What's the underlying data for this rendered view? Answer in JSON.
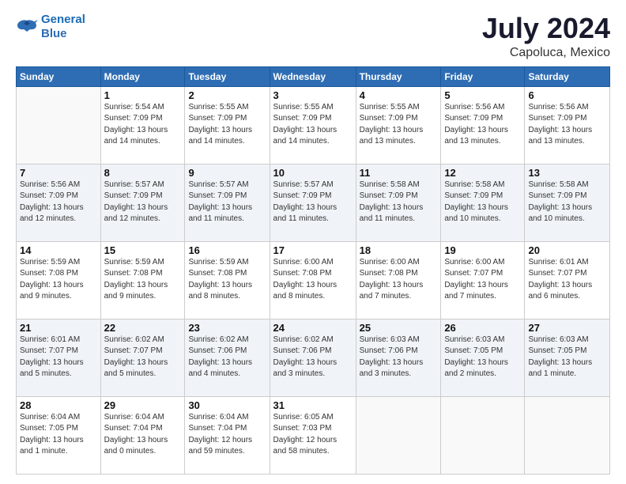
{
  "logo": {
    "line1": "General",
    "line2": "Blue"
  },
  "title": "July 2024",
  "location": "Capoluca, Mexico",
  "days_of_week": [
    "Sunday",
    "Monday",
    "Tuesday",
    "Wednesday",
    "Thursday",
    "Friday",
    "Saturday"
  ],
  "weeks": [
    [
      {
        "day": "",
        "info": ""
      },
      {
        "day": "1",
        "info": "Sunrise: 5:54 AM\nSunset: 7:09 PM\nDaylight: 13 hours\nand 14 minutes."
      },
      {
        "day": "2",
        "info": "Sunrise: 5:55 AM\nSunset: 7:09 PM\nDaylight: 13 hours\nand 14 minutes."
      },
      {
        "day": "3",
        "info": "Sunrise: 5:55 AM\nSunset: 7:09 PM\nDaylight: 13 hours\nand 14 minutes."
      },
      {
        "day": "4",
        "info": "Sunrise: 5:55 AM\nSunset: 7:09 PM\nDaylight: 13 hours\nand 13 minutes."
      },
      {
        "day": "5",
        "info": "Sunrise: 5:56 AM\nSunset: 7:09 PM\nDaylight: 13 hours\nand 13 minutes."
      },
      {
        "day": "6",
        "info": "Sunrise: 5:56 AM\nSunset: 7:09 PM\nDaylight: 13 hours\nand 13 minutes."
      }
    ],
    [
      {
        "day": "7",
        "info": "Sunrise: 5:56 AM\nSunset: 7:09 PM\nDaylight: 13 hours\nand 12 minutes."
      },
      {
        "day": "8",
        "info": "Sunrise: 5:57 AM\nSunset: 7:09 PM\nDaylight: 13 hours\nand 12 minutes."
      },
      {
        "day": "9",
        "info": "Sunrise: 5:57 AM\nSunset: 7:09 PM\nDaylight: 13 hours\nand 11 minutes."
      },
      {
        "day": "10",
        "info": "Sunrise: 5:57 AM\nSunset: 7:09 PM\nDaylight: 13 hours\nand 11 minutes."
      },
      {
        "day": "11",
        "info": "Sunrise: 5:58 AM\nSunset: 7:09 PM\nDaylight: 13 hours\nand 11 minutes."
      },
      {
        "day": "12",
        "info": "Sunrise: 5:58 AM\nSunset: 7:09 PM\nDaylight: 13 hours\nand 10 minutes."
      },
      {
        "day": "13",
        "info": "Sunrise: 5:58 AM\nSunset: 7:09 PM\nDaylight: 13 hours\nand 10 minutes."
      }
    ],
    [
      {
        "day": "14",
        "info": "Sunrise: 5:59 AM\nSunset: 7:08 PM\nDaylight: 13 hours\nand 9 minutes."
      },
      {
        "day": "15",
        "info": "Sunrise: 5:59 AM\nSunset: 7:08 PM\nDaylight: 13 hours\nand 9 minutes."
      },
      {
        "day": "16",
        "info": "Sunrise: 5:59 AM\nSunset: 7:08 PM\nDaylight: 13 hours\nand 8 minutes."
      },
      {
        "day": "17",
        "info": "Sunrise: 6:00 AM\nSunset: 7:08 PM\nDaylight: 13 hours\nand 8 minutes."
      },
      {
        "day": "18",
        "info": "Sunrise: 6:00 AM\nSunset: 7:08 PM\nDaylight: 13 hours\nand 7 minutes."
      },
      {
        "day": "19",
        "info": "Sunrise: 6:00 AM\nSunset: 7:07 PM\nDaylight: 13 hours\nand 7 minutes."
      },
      {
        "day": "20",
        "info": "Sunrise: 6:01 AM\nSunset: 7:07 PM\nDaylight: 13 hours\nand 6 minutes."
      }
    ],
    [
      {
        "day": "21",
        "info": "Sunrise: 6:01 AM\nSunset: 7:07 PM\nDaylight: 13 hours\nand 5 minutes."
      },
      {
        "day": "22",
        "info": "Sunrise: 6:02 AM\nSunset: 7:07 PM\nDaylight: 13 hours\nand 5 minutes."
      },
      {
        "day": "23",
        "info": "Sunrise: 6:02 AM\nSunset: 7:06 PM\nDaylight: 13 hours\nand 4 minutes."
      },
      {
        "day": "24",
        "info": "Sunrise: 6:02 AM\nSunset: 7:06 PM\nDaylight: 13 hours\nand 3 minutes."
      },
      {
        "day": "25",
        "info": "Sunrise: 6:03 AM\nSunset: 7:06 PM\nDaylight: 13 hours\nand 3 minutes."
      },
      {
        "day": "26",
        "info": "Sunrise: 6:03 AM\nSunset: 7:05 PM\nDaylight: 13 hours\nand 2 minutes."
      },
      {
        "day": "27",
        "info": "Sunrise: 6:03 AM\nSunset: 7:05 PM\nDaylight: 13 hours\nand 1 minute."
      }
    ],
    [
      {
        "day": "28",
        "info": "Sunrise: 6:04 AM\nSunset: 7:05 PM\nDaylight: 13 hours\nand 1 minute."
      },
      {
        "day": "29",
        "info": "Sunrise: 6:04 AM\nSunset: 7:04 PM\nDaylight: 13 hours\nand 0 minutes."
      },
      {
        "day": "30",
        "info": "Sunrise: 6:04 AM\nSunset: 7:04 PM\nDaylight: 12 hours\nand 59 minutes."
      },
      {
        "day": "31",
        "info": "Sunrise: 6:05 AM\nSunset: 7:03 PM\nDaylight: 12 hours\nand 58 minutes."
      },
      {
        "day": "",
        "info": ""
      },
      {
        "day": "",
        "info": ""
      },
      {
        "day": "",
        "info": ""
      }
    ]
  ]
}
